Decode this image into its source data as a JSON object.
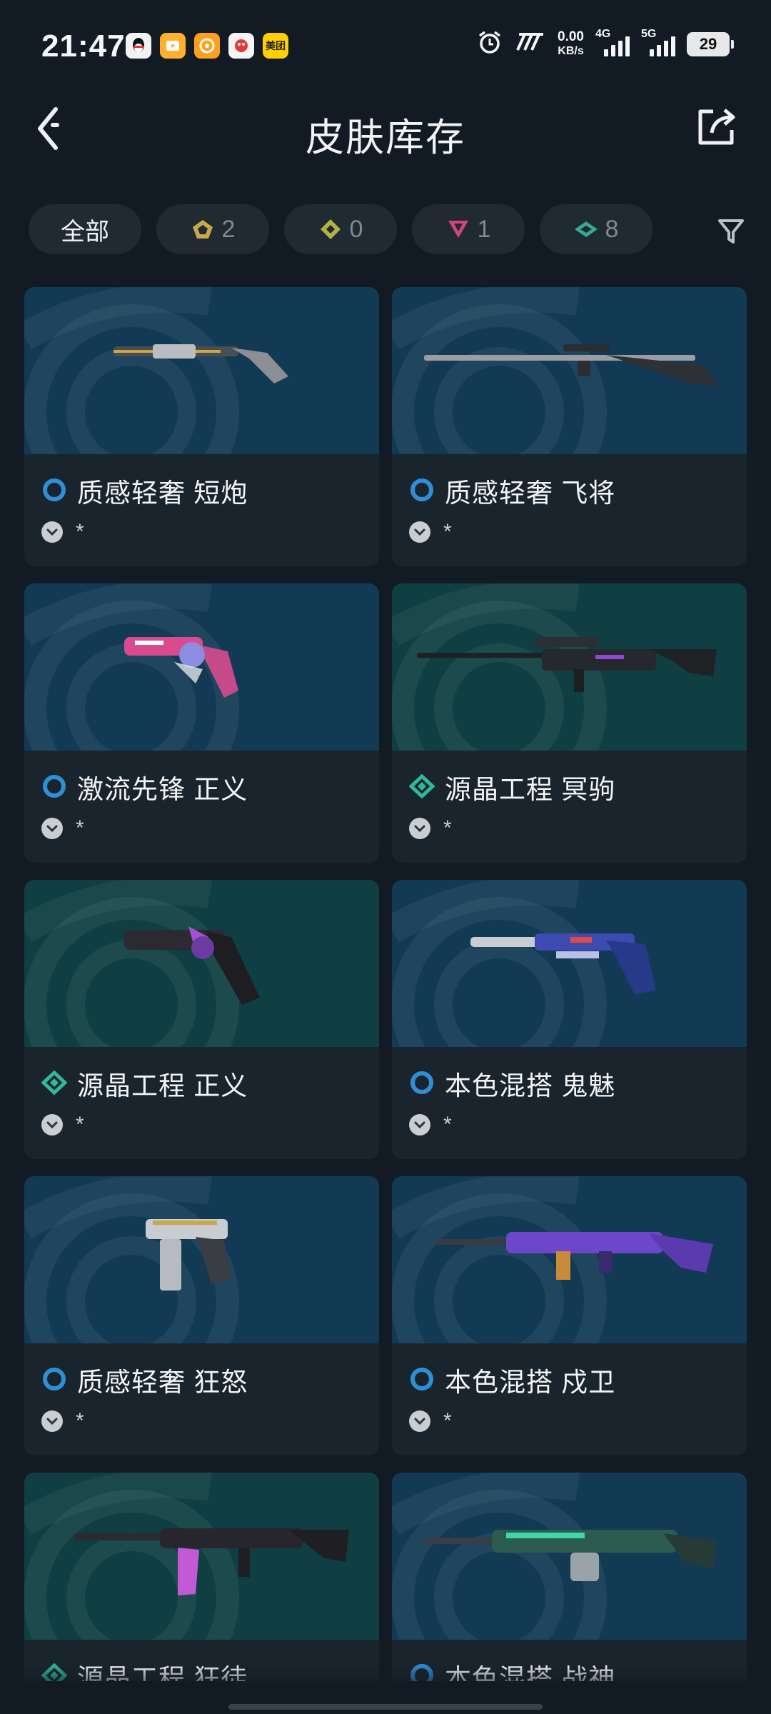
{
  "status_bar": {
    "time": "21:47",
    "app_icons": [
      "qq-icon",
      "video-app-icon",
      "target-app-icon",
      "game-app-icon",
      "meituan-icon"
    ],
    "meituan_label": "美团",
    "net_speed_value": "0.00",
    "net_speed_unit": "KB/s",
    "signal1_label": "4G",
    "signal2_label": "5G",
    "battery": "29"
  },
  "header": {
    "title": "皮肤库存"
  },
  "filters": [
    {
      "label": "全部",
      "tier": "",
      "active": true
    },
    {
      "label": "2",
      "tier": "exclusive",
      "color": "#c9a84a"
    },
    {
      "label": "0",
      "tier": "premium",
      "color": "#b3b341"
    },
    {
      "label": "1",
      "tier": "deluxe",
      "color": "#d1457a"
    },
    {
      "label": "8",
      "tier": "select",
      "color": "#39a890"
    }
  ],
  "colors": {
    "select_tier": "#2f8fd6",
    "deluxe_tier": "#2fb89a",
    "art_blue": "#133a55",
    "art_green": "#0f3f42"
  },
  "skins": [
    {
      "name": "质感轻奢 短炮",
      "tier": "select",
      "bg": "blue",
      "gun": "shotgun",
      "badge": "*"
    },
    {
      "name": "质感轻奢 飞将",
      "tier": "select",
      "bg": "blue",
      "gun": "sniper",
      "badge": "*"
    },
    {
      "name": "激流先锋 正义",
      "tier": "select",
      "bg": "blue",
      "gun": "revolver-pink",
      "badge": "*"
    },
    {
      "name": "源晶工程 冥驹",
      "tier": "deluxe",
      "bg": "green",
      "gun": "operator",
      "badge": "*"
    },
    {
      "name": "源晶工程 正义",
      "tier": "deluxe",
      "bg": "green",
      "gun": "revolver-dark",
      "badge": "*"
    },
    {
      "name": "本色混搭 鬼魅",
      "tier": "select",
      "bg": "blue",
      "gun": "pistol-suppressed",
      "badge": "*"
    },
    {
      "name": "质感轻奢 狂怒",
      "tier": "select",
      "bg": "blue",
      "gun": "smg-silver",
      "badge": "*"
    },
    {
      "name": "本色混搭 戍卫",
      "tier": "select",
      "bg": "blue",
      "gun": "rifle-purple",
      "badge": "*"
    },
    {
      "name": "源晶工程 狂徒",
      "tier": "deluxe",
      "bg": "green",
      "gun": "vandal",
      "badge": "*"
    },
    {
      "name": "本色混搭 战神",
      "tier": "select",
      "bg": "blue",
      "gun": "lmg",
      "badge": "*"
    }
  ]
}
